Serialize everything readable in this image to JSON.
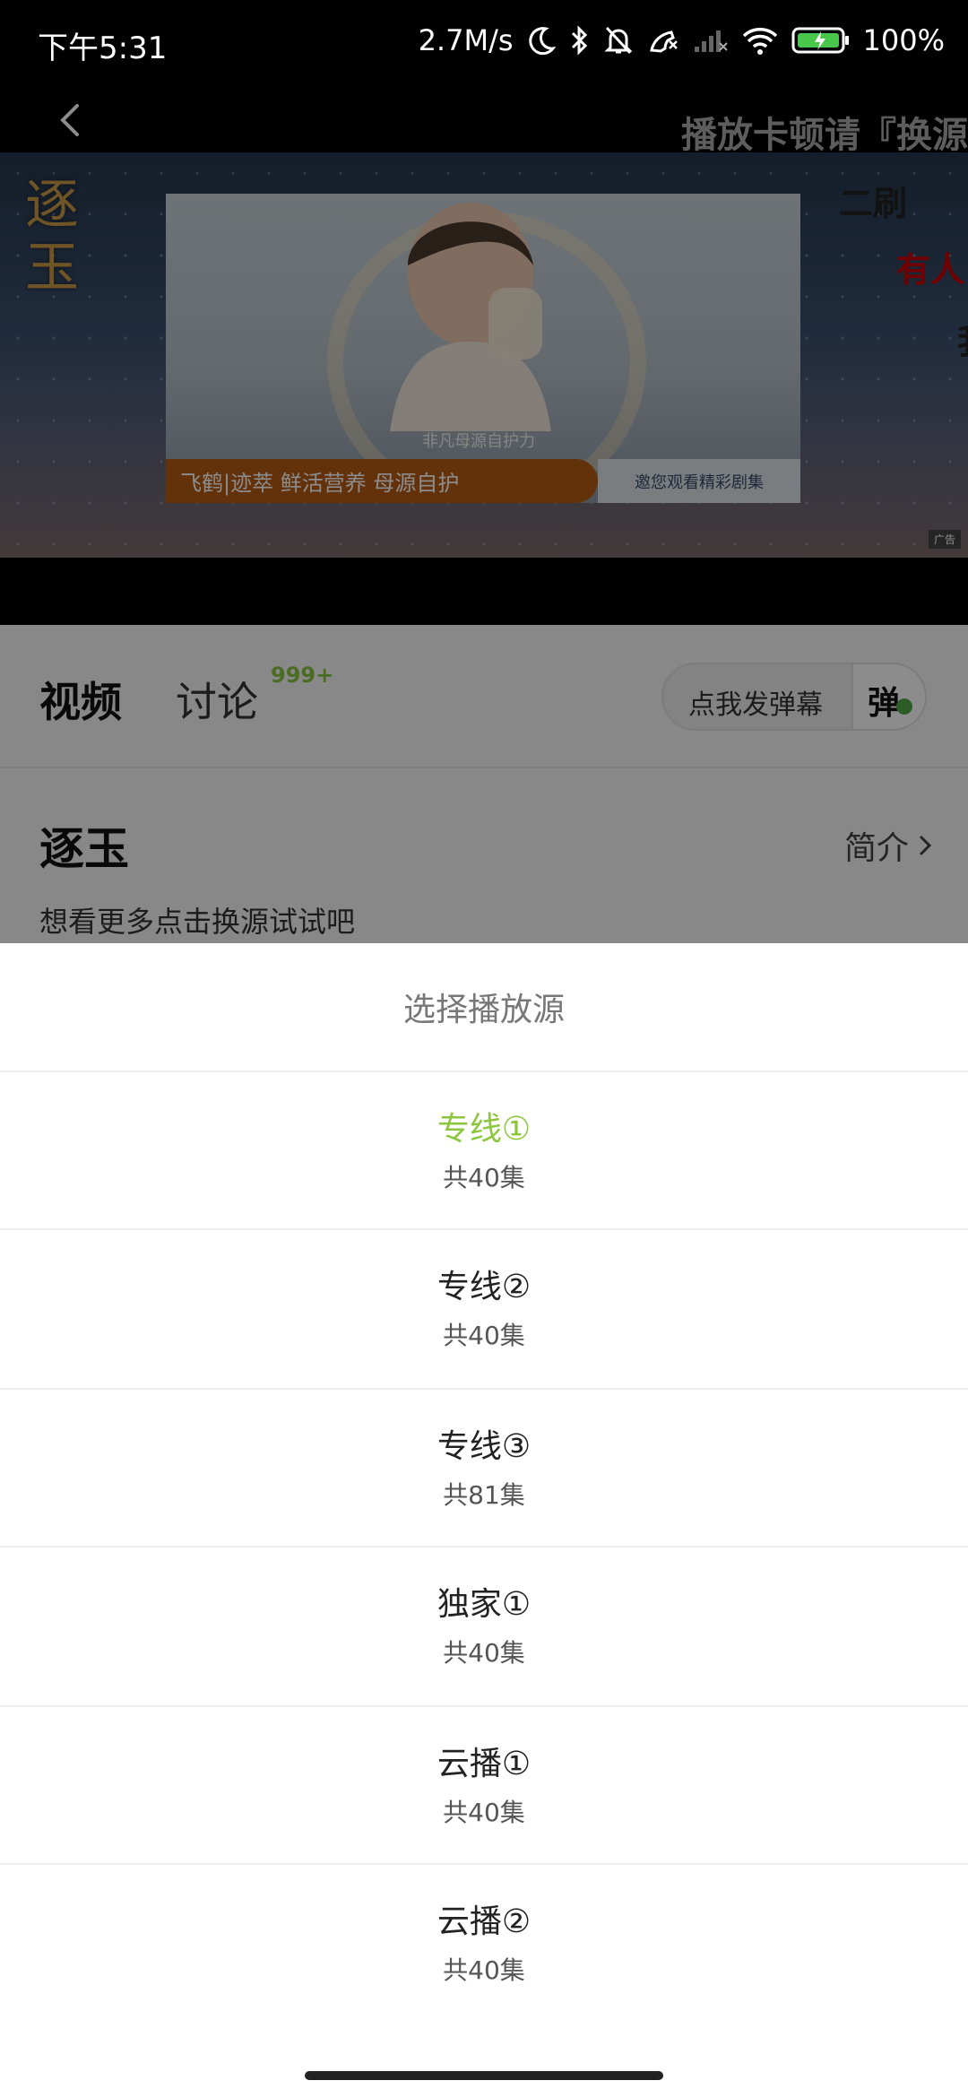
{
  "status_bar": {
    "time": "下午5:31",
    "speed": "2.7M/s",
    "battery": "100%",
    "icons": [
      "moon-icon",
      "bluetooth-icon",
      "bell-off-icon",
      "call-icon",
      "signal-icon",
      "wifi-icon",
      "battery-icon"
    ]
  },
  "player": {
    "marquee": "播放卡顿请『换源",
    "danmaku": [
      "二刷",
      "有人",
      "我"
    ],
    "ad": {
      "logo_text": "逐玉",
      "caption": "非凡母源自护力",
      "banner": "飞鹤|迹萃   鲜活营养  母源自护",
      "invite": "邀您观看精彩剧集",
      "label": "广告"
    }
  },
  "tabs": {
    "video": "视频",
    "discuss": "讨论",
    "discuss_badge": "999+"
  },
  "danmaku_button": {
    "label": "点我发弹幕",
    "icon_text": "弹"
  },
  "show": {
    "title": "逐玉",
    "intro_link": "简介",
    "hint": "想看更多点击换源试试吧"
  },
  "source_sheet": {
    "title": "选择播放源",
    "active_color": "#8cc63f",
    "sources": [
      {
        "name": "专线①",
        "count": "共40集"
      },
      {
        "name": "专线②",
        "count": "共40集"
      },
      {
        "name": "专线③",
        "count": "共81集"
      },
      {
        "name": "独家①",
        "count": "共40集"
      },
      {
        "name": "云播①",
        "count": "共40集"
      },
      {
        "name": "云播②",
        "count": "共40集"
      }
    ]
  }
}
